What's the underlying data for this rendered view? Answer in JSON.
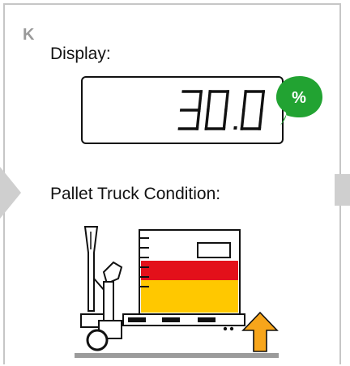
{
  "section_letter": "K",
  "display": {
    "label": "Display:",
    "value": "30.0",
    "unit_badge": "%"
  },
  "condition": {
    "label": "Pallet Truck Condition:"
  },
  "icons": {
    "unit_badge": "speech-bubble-icon",
    "nav_left": "arrow-left-icon",
    "truck": "pallet-truck-icon",
    "lift": "arrow-up-icon"
  },
  "colors": {
    "badge_green": "#22a332",
    "fill_red": "#e3101a",
    "fill_yellow": "#ffc800",
    "arrow_orange": "#f7a51b",
    "nav_gray": "#cfcfcf"
  }
}
